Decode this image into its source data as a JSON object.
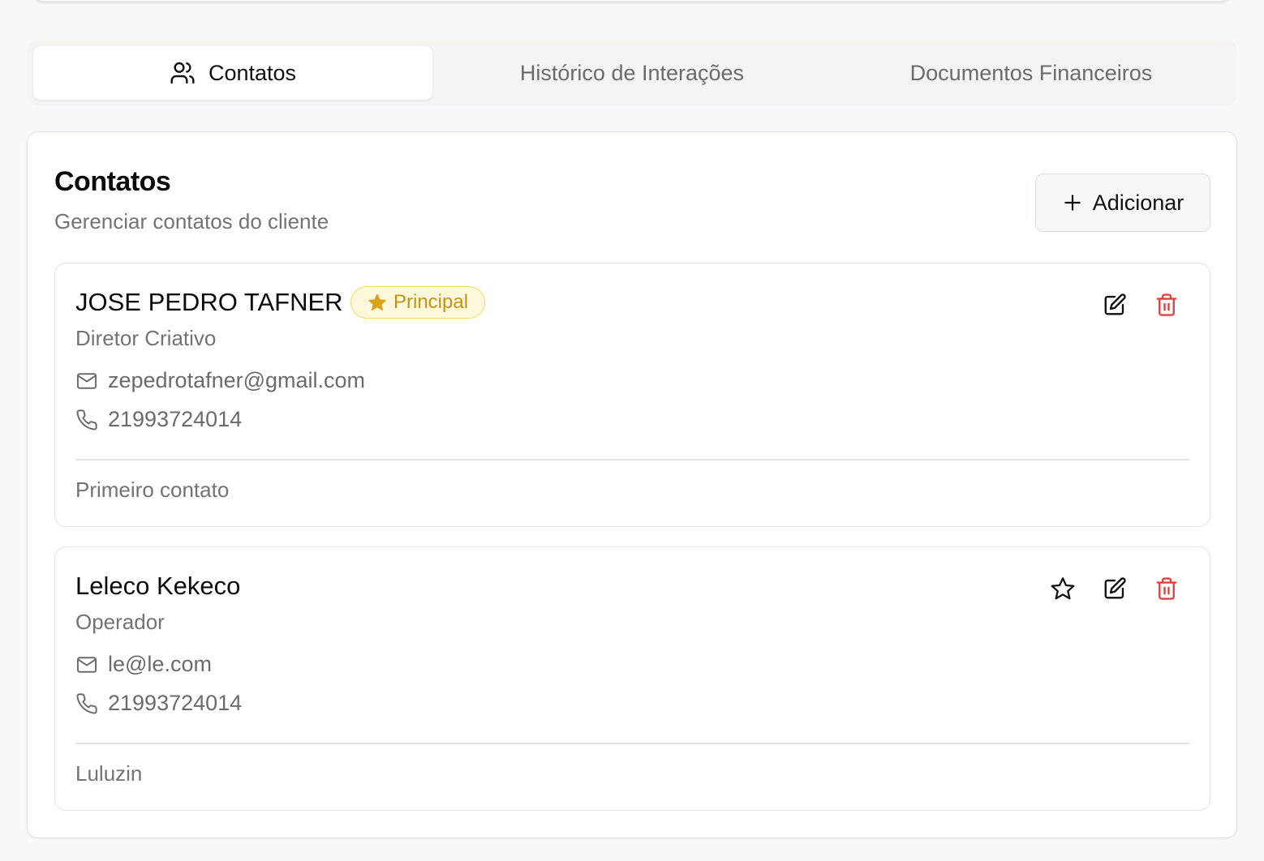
{
  "tabs": [
    {
      "label": "Contatos",
      "icon": "users-icon",
      "active": true
    },
    {
      "label": "Histórico de Interações",
      "active": false
    },
    {
      "label": "Documentos Financeiros",
      "active": false
    }
  ],
  "panel": {
    "title": "Contatos",
    "subtitle": "Gerenciar contatos do cliente",
    "add_label": "Adicionar"
  },
  "contacts": [
    {
      "name": "JOSE PEDRO TAFNER",
      "badge": "Principal",
      "role": "Diretor Criativo",
      "email": "zepedrotafner@gmail.com",
      "phone": "21993724014",
      "notes": "Primeiro contato"
    },
    {
      "name": "Leleco Kekeco",
      "role": "Operador",
      "email": "le@le.com",
      "phone": "21993724014",
      "notes": "Luluzin"
    }
  ],
  "colors": {
    "badge_text": "#c29412",
    "badge_bg": "#fdf8dc",
    "badge_border": "#f2d96a",
    "delete": "#e0413f",
    "muted_text": "#737373"
  }
}
